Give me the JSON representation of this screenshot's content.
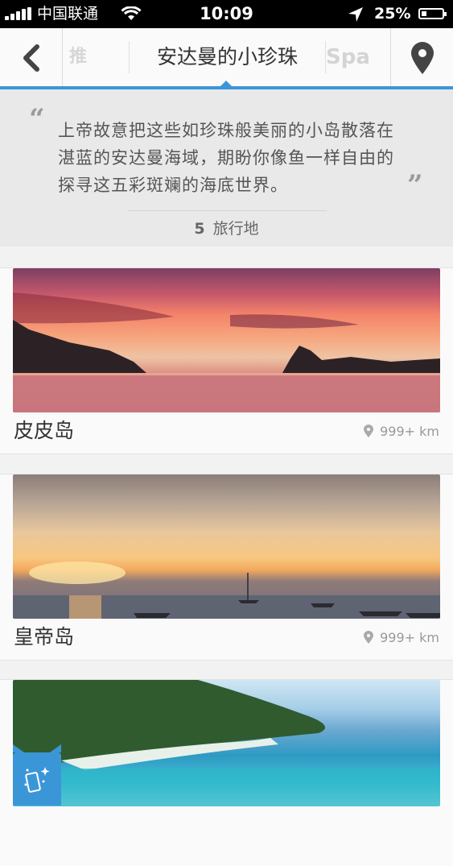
{
  "status_bar": {
    "carrier": "中国联通",
    "time": "10:09",
    "battery": "25%"
  },
  "nav": {
    "prev_tab": "推",
    "title": "安达曼的小珍珠",
    "next_tab": "Spa"
  },
  "quote": {
    "open_mark": "“",
    "close_mark": "”",
    "text": "上帝故意把这些如珍珠般美丽的小岛散落在湛蓝的安达曼海域，期盼你像鱼一样自由的探寻这五彩斑斓的海底世界。",
    "count": "5",
    "count_label": "旅行地"
  },
  "places": [
    {
      "name": "皮皮岛",
      "distance": "999+ km"
    },
    {
      "name": "皇帝岛",
      "distance": "999+ km"
    }
  ],
  "icons": {
    "back": "chevron-left-icon",
    "location": "map-pin-icon",
    "fab": "phone-sparkle-icon"
  },
  "colors": {
    "accent": "#3b96d8",
    "status_bar": "#000000"
  }
}
